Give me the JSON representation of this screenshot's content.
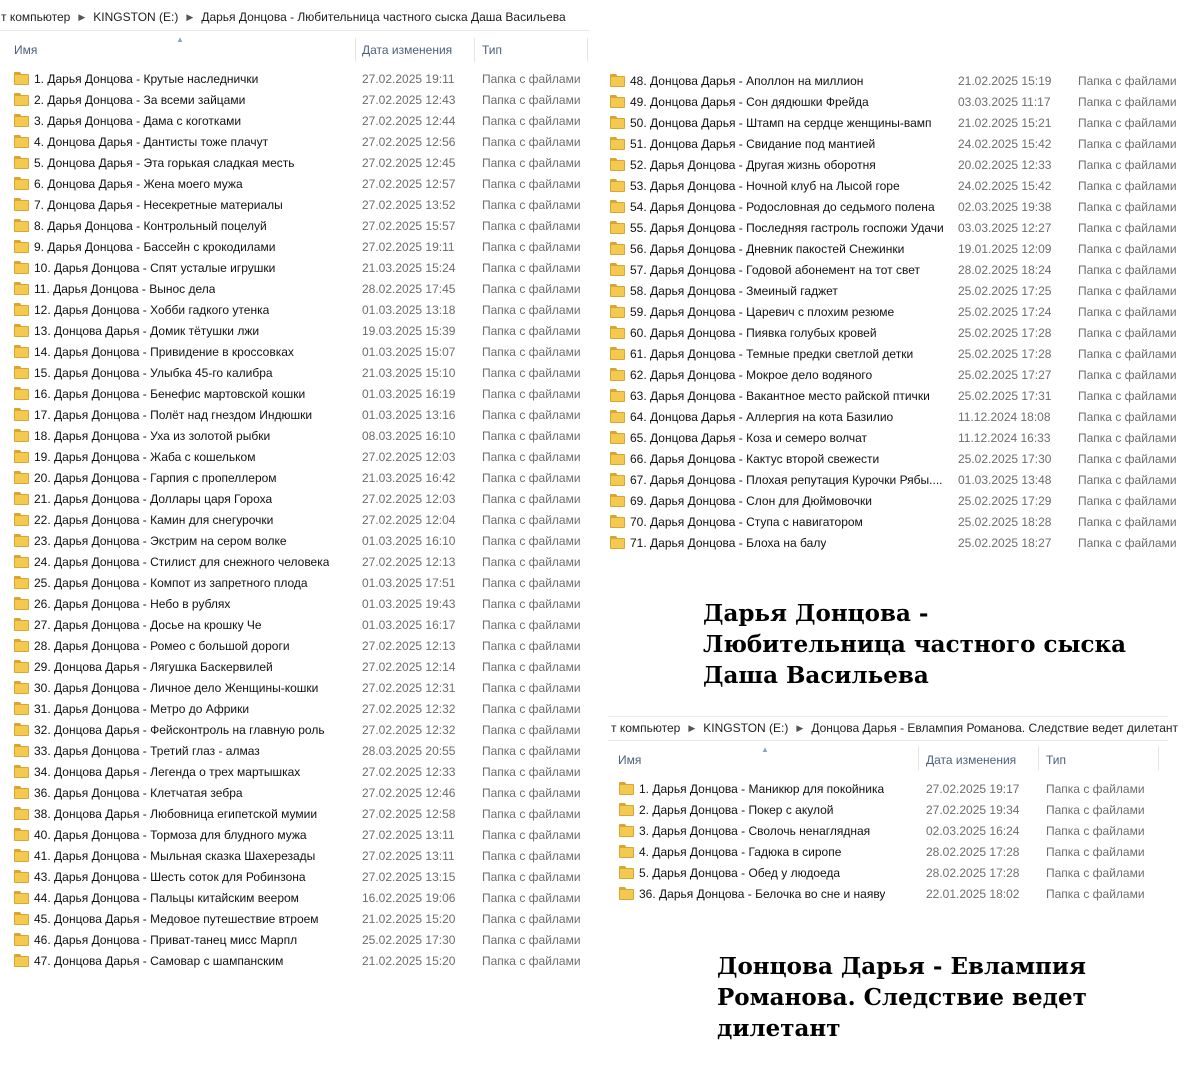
{
  "panel1": {
    "breadcrumb": [
      "т компьютер",
      "KINGSTON (E:)",
      "Дарья Донцова - Любительница частного сыска Даша Васильева"
    ],
    "headers": {
      "name": "Имя",
      "date": "Дата изменения",
      "type": "Тип"
    }
  },
  "list1": [
    {
      "name": "1. Дарья Донцова - Крутые наследнички",
      "date": "27.02.2025 19:11",
      "type": "Папка с файлами"
    },
    {
      "name": "2. Дарья Донцова - За всеми зайцами",
      "date": "27.02.2025 12:43",
      "type": "Папка с файлами"
    },
    {
      "name": "3. Дарья Донцова - Дама с коготками",
      "date": "27.02.2025 12:44",
      "type": "Папка с файлами"
    },
    {
      "name": "4. Донцова Дарья - Дантисты тоже плачут",
      "date": "27.02.2025 12:56",
      "type": "Папка с файлами"
    },
    {
      "name": "5. Донцова Дарья - Эта горькая сладкая месть",
      "date": "27.02.2025 12:45",
      "type": "Папка с файлами"
    },
    {
      "name": "6. Донцова Дарья - Жена моего мужа",
      "date": "27.02.2025 12:57",
      "type": "Папка с файлами"
    },
    {
      "name": "7. Донцова Дарья - Несекретные материалы",
      "date": "27.02.2025 13:52",
      "type": "Папка с файлами"
    },
    {
      "name": "8. Дарья Донцова - Контрольный поцелуй",
      "date": "27.02.2025 15:57",
      "type": "Папка с файлами"
    },
    {
      "name": "9. Дарья Донцова - Бассейн с крокодилами",
      "date": "27.02.2025 19:11",
      "type": "Папка с файлами"
    },
    {
      "name": "10. Дарья Донцова - Спят усталые игрушки",
      "date": "21.03.2025 15:24",
      "type": "Папка с файлами"
    },
    {
      "name": "11. Дарья Донцова - Вынос дела",
      "date": "28.02.2025 17:45",
      "type": "Папка с файлами"
    },
    {
      "name": "12. Дарья Донцова - Хобби гадкого утенка",
      "date": "01.03.2025 13:18",
      "type": "Папка с файлами"
    },
    {
      "name": "13. Донцова Дарья - Домик тётушки лжи",
      "date": "19.03.2025 15:39",
      "type": "Папка с файлами"
    },
    {
      "name": "14. Дарья Донцова - Привидение в кроссовках",
      "date": "01.03.2025 15:07",
      "type": "Папка с файлами"
    },
    {
      "name": "15. Дарья Донцова - Улыбка 45-го калибра",
      "date": "21.03.2025 15:10",
      "type": "Папка с файлами"
    },
    {
      "name": "16. Дарья Донцова - Бенефис мартовской кошки",
      "date": "01.03.2025 16:19",
      "type": "Папка с файлами"
    },
    {
      "name": "17. Дарья Донцова - Полёт над гнездом Индюшки",
      "date": "01.03.2025 13:16",
      "type": "Папка с файлами"
    },
    {
      "name": "18. Дарья Донцова - Уха из золотой рыбки",
      "date": "08.03.2025 16:10",
      "type": "Папка с файлами"
    },
    {
      "name": "19. Дарья Донцова -  Жаба с кошельком",
      "date": "27.02.2025 12:03",
      "type": "Папка с файлами"
    },
    {
      "name": "20. Дарья Донцова - Гарпия с пропеллером",
      "date": "21.03.2025 16:42",
      "type": "Папка с файлами"
    },
    {
      "name": "21. Дарья Донцова - Доллары царя Гороха",
      "date": "27.02.2025 12:03",
      "type": "Папка с файлами"
    },
    {
      "name": "22. Дарья Донцова - Камин для снегурочки",
      "date": "27.02.2025 12:04",
      "type": "Папка с файлами"
    },
    {
      "name": "23. Дарья Донцова - Экстрим на сером волке",
      "date": "01.03.2025 16:10",
      "type": "Папка с файлами"
    },
    {
      "name": "24. Дарья Донцова - Стилист для снежного человека",
      "date": "27.02.2025 12:13",
      "type": "Папка с файлами"
    },
    {
      "name": "25. Дарья Донцова - Компот из запретного плода",
      "date": "01.03.2025 17:51",
      "type": "Папка с файлами"
    },
    {
      "name": "26. Дарья Донцова - Небо в рублях",
      "date": "01.03.2025 19:43",
      "type": "Папка с файлами"
    },
    {
      "name": "27. Дарья Донцова - Досье на крошку Че",
      "date": "01.03.2025 16:17",
      "type": "Папка с файлами"
    },
    {
      "name": "28. Дарья Донцова - Ромео с большой дороги",
      "date": "27.02.2025 12:13",
      "type": "Папка с файлами"
    },
    {
      "name": "29. Донцова Дарья -  Лягушка Баскервилей",
      "date": "27.02.2025 12:14",
      "type": "Папка с файлами"
    },
    {
      "name": "30. Дарья Донцова - Личное дело Женщины-кошки",
      "date": "27.02.2025 12:31",
      "type": "Папка с файлами"
    },
    {
      "name": "31. Дарья Донцова - Метро до Африки",
      "date": "27.02.2025 12:32",
      "type": "Папка с файлами"
    },
    {
      "name": "32. Донцова Дарья - Фейсконтроль на главную роль",
      "date": "27.02.2025 12:32",
      "type": "Папка с файлами"
    },
    {
      "name": "33. Дарья Донцова - Третий глаз - алмаз",
      "date": "28.03.2025 20:55",
      "type": "Папка с файлами"
    },
    {
      "name": "34. Донцова Дарья - Легенда о трех мартышках",
      "date": "27.02.2025 12:33",
      "type": "Папка с файлами"
    },
    {
      "name": "36. Дарья Донцова - Клетчатая зебра",
      "date": "27.02.2025 12:46",
      "type": "Папка с файлами"
    },
    {
      "name": "38. Донцова Дарья - Любовница египетской мумии",
      "date": "27.02.2025 12:58",
      "type": "Папка с файлами"
    },
    {
      "name": "40. Дарья Донцова - Тормоза для блудного мужа",
      "date": "27.02.2025 13:11",
      "type": "Папка с файлами"
    },
    {
      "name": "41. Дарья Донцова - Мыльная сказка Шахерезады",
      "date": "27.02.2025 13:11",
      "type": "Папка с файлами"
    },
    {
      "name": "43. Дарья Донцова - Шесть соток для Робинзона",
      "date": "27.02.2025 13:15",
      "type": "Папка с файлами"
    },
    {
      "name": "44. Дарья Донцова - Пальцы китайским веером",
      "date": "16.02.2025 19:06",
      "type": "Папка с файлами"
    },
    {
      "name": "45. Донцова Дарья - Медовое путешествие втроем",
      "date": "21.02.2025 15:20",
      "type": "Папка с файлами"
    },
    {
      "name": "46. Дарья Донцова - Приват-танец мисс Марпл",
      "date": "25.02.2025 17:30",
      "type": "Папка с файлами"
    },
    {
      "name": "47. Донцова Дарья - Самовар с шампанским",
      "date": "21.02.2025 15:20",
      "type": "Папка с файлами"
    }
  ],
  "list2": [
    {
      "name": "48. Донцова Дарья - Аполлон на миллион",
      "date": "21.02.2025 15:19",
      "type": "Папка с файлами"
    },
    {
      "name": "49. Донцова Дарья - Сон дядюшки Фрейда",
      "date": "03.03.2025 11:17",
      "type": "Папка с файлами"
    },
    {
      "name": "50. Донцова Дарья - Штамп на сердце женщины-вамп",
      "date": "21.02.2025 15:21",
      "type": "Папка с файлами"
    },
    {
      "name": "51. Донцова Дарья - Свидание под мантией",
      "date": "24.02.2025 15:42",
      "type": "Папка с файлами"
    },
    {
      "name": "52. Дарья Донцова - Другая жизнь оборотня",
      "date": "20.02.2025 12:33",
      "type": "Папка с файлами"
    },
    {
      "name": "53. Дарья Донцова - Ночной клуб на Лысой горе",
      "date": "24.02.2025 15:42",
      "type": "Папка с файлами"
    },
    {
      "name": "54. Дарья Донцова - Родословная до седьмого полена",
      "date": "02.03.2025 19:38",
      "type": "Папка с файлами"
    },
    {
      "name": "55. Дарья Донцова - Последняя гастроль госпожи Удачи",
      "date": "03.03.2025 12:27",
      "type": "Папка с файлами"
    },
    {
      "name": "56. Дарья Донцова - Дневник пакостей Снежинки",
      "date": "19.01.2025 12:09",
      "type": "Папка с файлами"
    },
    {
      "name": "57. Дарья Донцова -  Годовой абонемент на тот свет",
      "date": "28.02.2025 18:24",
      "type": "Папка с файлами"
    },
    {
      "name": "58. Дарья Донцова - Змеиный гаджет",
      "date": "25.02.2025 17:25",
      "type": "Папка с файлами"
    },
    {
      "name": "59. Дарья Донцова - Царевич с плохим резюме",
      "date": "25.02.2025 17:24",
      "type": "Папка с файлами"
    },
    {
      "name": "60. Дарья Донцова - Пиявка голубых кровей",
      "date": "25.02.2025 17:28",
      "type": "Папка с файлами"
    },
    {
      "name": "61. Дарья Донцова - Темные предки светлой детки",
      "date": "25.02.2025 17:28",
      "type": "Папка с файлами"
    },
    {
      "name": "62. Дарья Донцова -  Мокрое дело водяного",
      "date": "25.02.2025 17:27",
      "type": "Папка с файлами"
    },
    {
      "name": "63. Дарья Донцова - Вакантное место райской птички",
      "date": "25.02.2025 17:31",
      "type": "Папка с файлами"
    },
    {
      "name": "64. Донцова Дарья - Аллергия на кота Базилио",
      "date": "11.12.2024 18:08",
      "type": "Папка с файлами"
    },
    {
      "name": "65. Донцова Дарья - Коза и семеро волчат",
      "date": "11.12.2024 16:33",
      "type": "Папка с файлами"
    },
    {
      "name": "66. Дарья Донцова - Кактус второй свежести",
      "date": "25.02.2025 17:30",
      "type": "Папка с файлами"
    },
    {
      "name": "67. Дарья Донцова - Плохая репутация Курочки Рябы....",
      "date": "01.03.2025 13:48",
      "type": "Папка с файлами"
    },
    {
      "name": "69. Дарья Донцова - Слон для Дюймовочки",
      "date": "25.02.2025 17:29",
      "type": "Папка с файлами"
    },
    {
      "name": "70. Дарья Донцова - Ступа с навигатором",
      "date": "25.02.2025 18:28",
      "type": "Папка с файлами"
    },
    {
      "name": "71. Дарья Донцова - Блоха на балу",
      "date": "25.02.2025 18:27",
      "type": "Папка с файлами"
    }
  ],
  "caption1": [
    "Дарья Донцова -",
    "Любительница частного сыска",
    "Даша Васильева"
  ],
  "panel2": {
    "breadcrumb": [
      "т компьютер",
      "KINGSTON (E:)",
      "Донцова Дарья - Евлампия Романова. Следствие ведет дилетант"
    ],
    "headers": {
      "name": "Имя",
      "date": "Дата изменения",
      "type": "Тип"
    }
  },
  "list3": [
    {
      "name": "1. Дарья Донцова - Маникюр для покойника",
      "date": "27.02.2025 19:17",
      "type": "Папка с файлами"
    },
    {
      "name": "2. Дарья Донцова - Покер с акулой",
      "date": "27.02.2025 19:34",
      "type": "Папка с файлами"
    },
    {
      "name": "3. Дарья Донцова - Сволочь ненаглядная",
      "date": "02.03.2025 16:24",
      "type": "Папка с файлами"
    },
    {
      "name": "4. Дарья Донцова - Гадюка в сиропе",
      "date": "28.02.2025 17:28",
      "type": "Папка с файлами"
    },
    {
      "name": "5. Дарья Донцова - Обед у людоеда",
      "date": "28.02.2025 17:28",
      "type": "Папка с файлами"
    },
    {
      "name": "36. Дарья Донцова - Белочка во сне и наяву",
      "date": "22.01.2025 18:02",
      "type": "Папка с файлами"
    }
  ],
  "caption2": [
    "Донцова Дарья - Евлампия",
    "Романова. Следствие ведет",
    "дилетант"
  ]
}
